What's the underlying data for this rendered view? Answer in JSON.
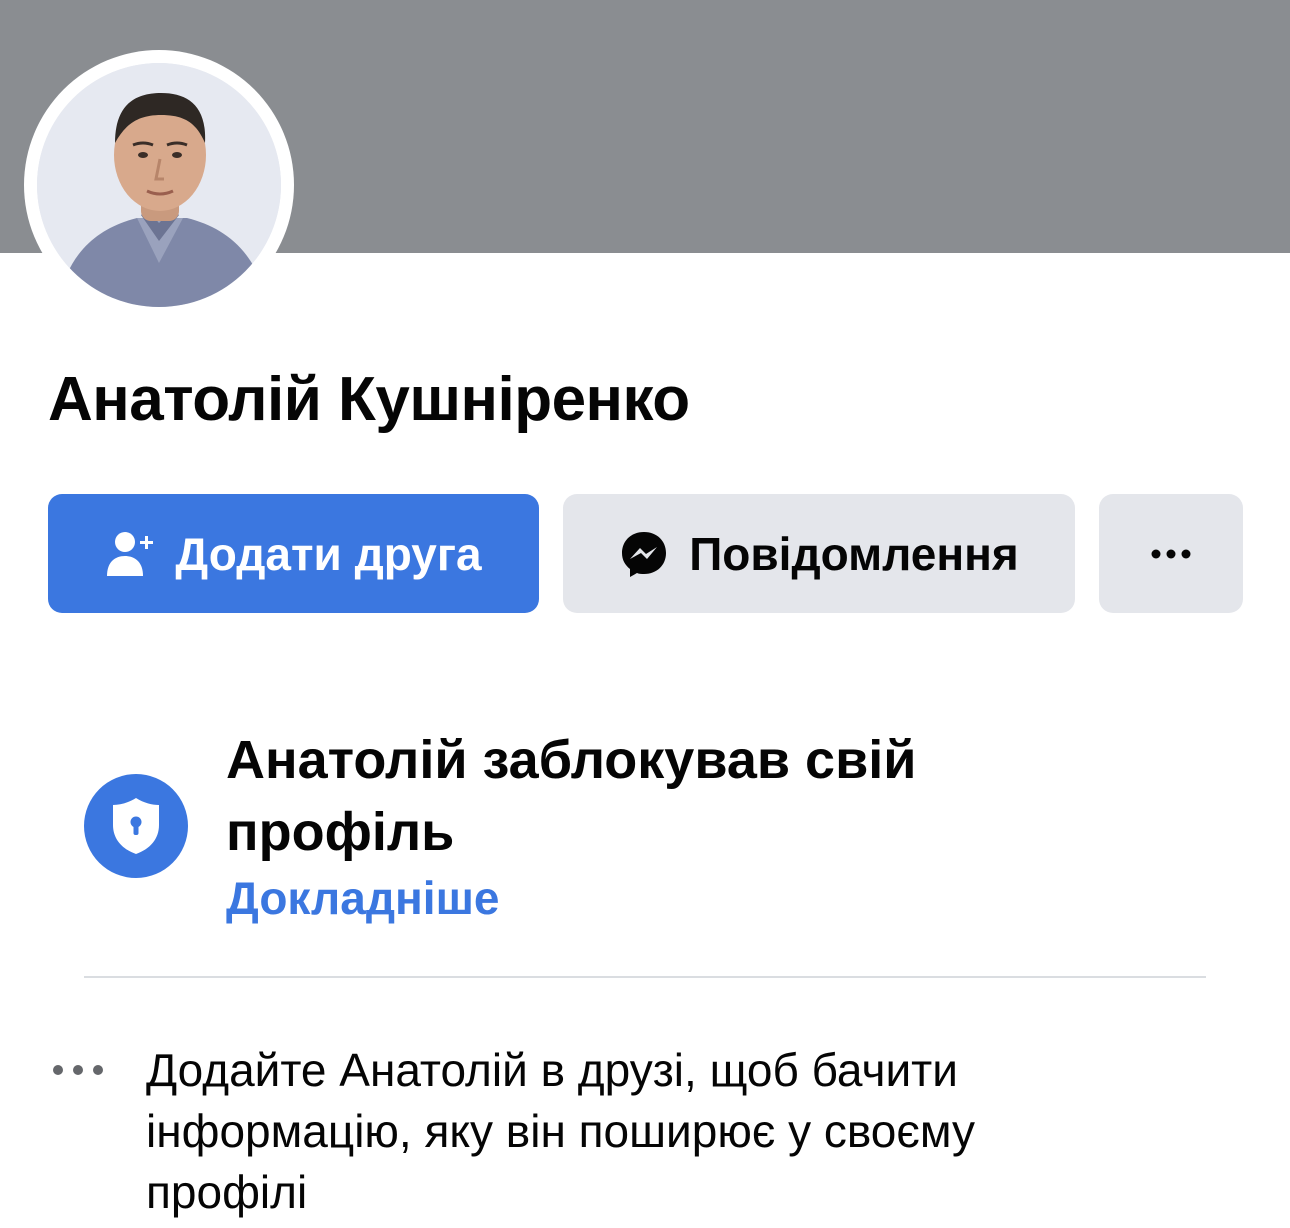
{
  "profile": {
    "name": "Анатолій Кушніренко"
  },
  "actions": {
    "add_friend_label": "Додати друга",
    "message_label": "Повідомлення"
  },
  "locked": {
    "title": "Анатолій заблокував свій профіль",
    "learn_more": "Докладніше"
  },
  "info": {
    "text": "Додайте Анатолій в друзі, щоб бачити інформацію, яку він поширює у своєму профілі"
  },
  "colors": {
    "accent": "#3b77e0",
    "cover": "#8a8d91",
    "secondary_button": "#e4e6eb"
  },
  "icons": {
    "add_friend": "person-plus-icon",
    "message": "messenger-icon",
    "more": "more-dots-icon",
    "lock": "shield-lock-icon",
    "info": "ellipsis-icon"
  }
}
